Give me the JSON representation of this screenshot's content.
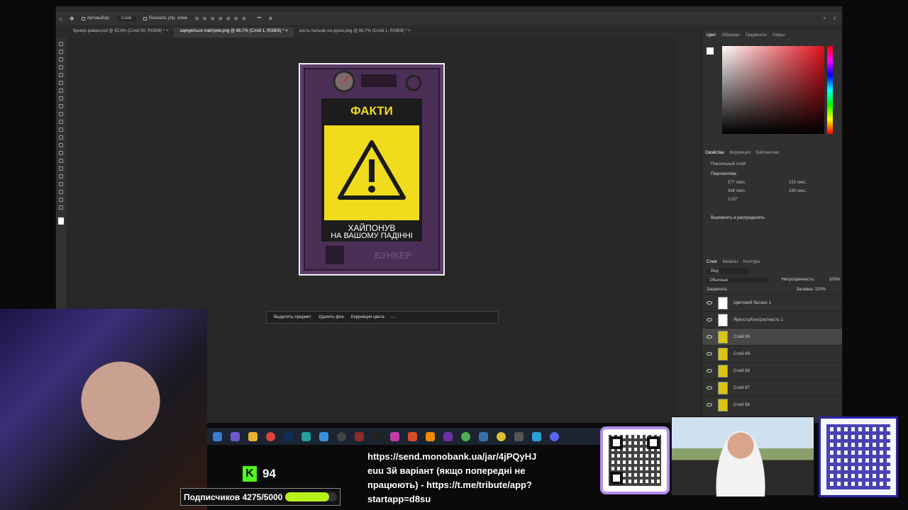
{
  "options_bar": {
    "autoselect": "Автовыбор:",
    "layer_select": "Слой",
    "show_transform": "Показать упр. элем."
  },
  "tabs": [
    "бункер рамка.psd @ 82,6% (Слой 90, RGB/8) *",
    "харчуються повітрям.png @ 66,7% (Слой 1, RGB/8) *",
    "шість пальців на руках.png @ 66,7% (Слой 1, RGB/8) *"
  ],
  "card": {
    "title": "ФАКТИ",
    "caption_line1": "ХАЙПОНУВ",
    "caption_line2": "НА ВАШОМУ ПАДІННІ",
    "bottom_plate": "БУНКЕР"
  },
  "context_bar": {
    "select_subject": "Выделить предмет",
    "remove_bg": "Удалить фон",
    "color_correction": "Коррекция цвета"
  },
  "color_panel": {
    "tabs": [
      "Цвет",
      "Образцы",
      "Градиенты",
      "Узоры"
    ],
    "active": "Цвет"
  },
  "properties_panel": {
    "tabs": [
      "Свойства",
      "Коррекция",
      "Библиотеки"
    ],
    "layer_type": "Пиксельный слой",
    "section_transform": "Перспектива",
    "w": "577 пикс.",
    "h": "848 пикс.",
    "x": "133 пикс.",
    "y": "196 пикс.",
    "angle": "0,00°",
    "section_align": "Выровнять и распределить"
  },
  "layers_panel": {
    "tabs": [
      "Слои",
      "Каналы",
      "Контуры"
    ],
    "search": "Вид",
    "blend": "Обычные",
    "opacity_label": "Непрозрачность:",
    "opacity": "100%",
    "lock_label": "Закрепить:",
    "fill_label": "Заливка:",
    "fill": "100%",
    "layers": [
      {
        "name": "Цветовой баланс 1",
        "selected": false
      },
      {
        "name": "Яркость/Контрастность 1",
        "selected": false
      },
      {
        "name": "Слой 90",
        "selected": true
      },
      {
        "name": "Слой 89",
        "selected": false
      },
      {
        "name": "Слой 88",
        "selected": false
      },
      {
        "name": "Слой 87",
        "selected": false
      },
      {
        "name": "Слой 86",
        "selected": false
      }
    ]
  },
  "stream_overlay": {
    "kick_count": "94",
    "subscribers": "Подписчиков 4275/5000",
    "subscribers_progress": 0.855,
    "donate_line1": "https://send.monobank.ua/jar/4jPQyHJ",
    "donate_line2": "euu 3й варіант (якщо попередні не",
    "donate_line3": "працюють) - https://t.me/tribute/app?",
    "donate_line4": "startapp=d8su"
  },
  "colors": {
    "card_yellow": "#f0dc1c",
    "frame_purple": "#5d3d6a",
    "kick_green": "#53fc18"
  }
}
